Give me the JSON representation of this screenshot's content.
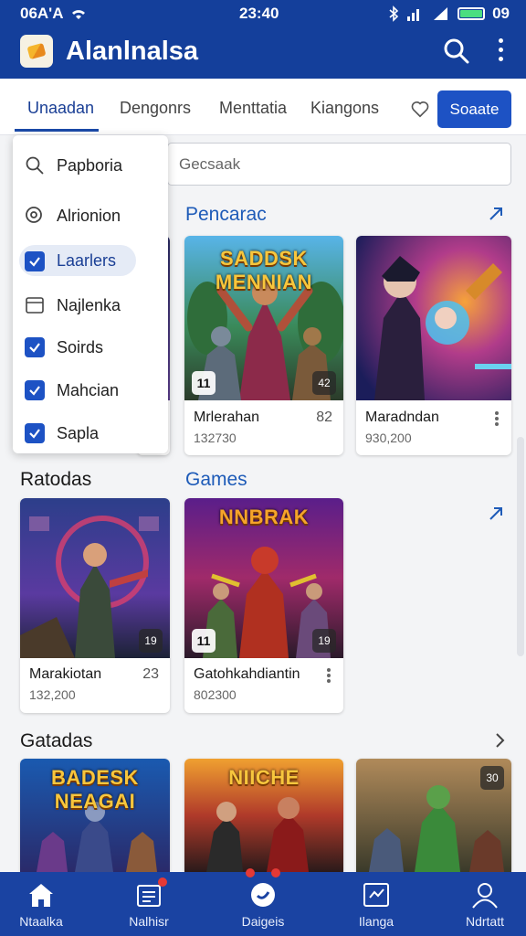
{
  "status_bar": {
    "carrier": "06A'A",
    "time": "23:40",
    "battery": "09"
  },
  "app_bar": {
    "title": "Alanlnalsa",
    "icons": [
      "search-icon",
      "more-vertical-icon"
    ]
  },
  "tabs": [
    {
      "label": "Unaadan",
      "active": true
    },
    {
      "label": "Dengonrs",
      "active": false
    },
    {
      "label": "Menttatia",
      "active": false
    },
    {
      "label": "Kiangons",
      "active": false
    }
  ],
  "toolbar": {
    "search_button": "Soaate"
  },
  "search": {
    "placeholder": "Gecsaak"
  },
  "dropdown": {
    "items": [
      {
        "label": "Papboria",
        "icon": "search-icon"
      },
      {
        "label": "Alrionion",
        "icon": "target-search-icon"
      },
      {
        "label": "Laarlers",
        "icon": "checkbox-checked",
        "highlighted": true
      },
      {
        "label": "Najlenka",
        "icon": "calendar-icon"
      },
      {
        "label": "Soirds",
        "icon": "checkbox-checked"
      },
      {
        "label": "Mahcian",
        "icon": "checkbox-checked"
      },
      {
        "label": "Sapla",
        "icon": "checkbox-checked"
      }
    ]
  },
  "sections": {
    "featured": {
      "title": "Pencarac",
      "cards": [
        {
          "art_title": "SADDSK MENNIAN",
          "name": "Mrlerahan",
          "score": "82",
          "sub": "132730",
          "badge": "11",
          "rating_badge": "42"
        },
        {
          "name": "Maradndan",
          "sub": "930,200"
        }
      ]
    },
    "ratodas": {
      "title": "Ratodas"
    },
    "games": {
      "title": "Games",
      "cards": [
        {
          "name": "Marakiotan",
          "score": "23",
          "sub": "132,200",
          "rating_badge": "19"
        },
        {
          "art_title": "NNBRAK",
          "name": "Gatohkahdiantin",
          "sub": "802300",
          "badge": "11",
          "rating_badge": "19"
        }
      ]
    },
    "gatadas": {
      "title": "Gatadas",
      "cards": [
        {
          "art_title": "BADESK NEAGAI"
        },
        {
          "art_title": "NIICHE"
        },
        {
          "rating_badge": "30"
        }
      ]
    }
  },
  "bottom_nav": [
    {
      "label": "Ntaalka",
      "icon": "home-icon"
    },
    {
      "label": "Nalhisr",
      "icon": "news-icon"
    },
    {
      "label": "Daigeis",
      "icon": "games-icon"
    },
    {
      "label": "Ilanga",
      "icon": "stats-icon"
    },
    {
      "label": "Ndrtatt",
      "icon": "profile-icon"
    }
  ],
  "colors": {
    "primary": "#143f9b",
    "accent": "#1d52c4",
    "link": "#1e5bb8"
  }
}
